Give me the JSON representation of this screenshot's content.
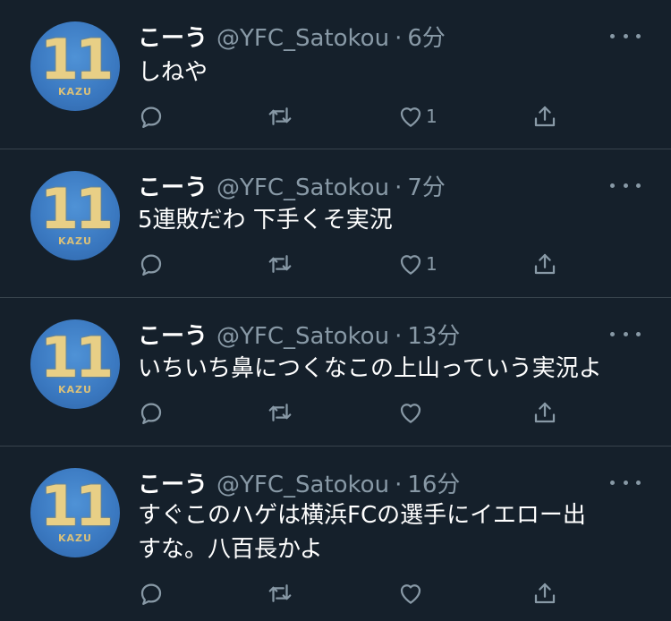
{
  "user": {
    "display_name": "こーう",
    "handle": "@YFC_Satokou",
    "avatar_number": "11",
    "avatar_text": "KAZU"
  },
  "tweets": [
    {
      "time": "6分",
      "text_lines": [
        "しねや"
      ],
      "like_count": "1"
    },
    {
      "time": "7分",
      "text_lines": [
        "5連敗だわ 下手くそ実況"
      ],
      "like_count": "1"
    },
    {
      "time": "13分",
      "text_lines": [
        "いちいち鼻につくなこの上山っていう実況よ"
      ],
      "like_count": ""
    },
    {
      "time": "16分",
      "text_lines": [
        "すぐこのハゲは横浜FCの選手にイエロー出",
        "すな。八百長かよ"
      ],
      "like_count": ""
    }
  ],
  "icons": [
    "reply-icon",
    "retweet-icon",
    "like-icon",
    "share-icon",
    "more-icon"
  ],
  "colors": {
    "background": "#15202b",
    "divider": "#38444d",
    "secondary_text": "#8899a6"
  }
}
